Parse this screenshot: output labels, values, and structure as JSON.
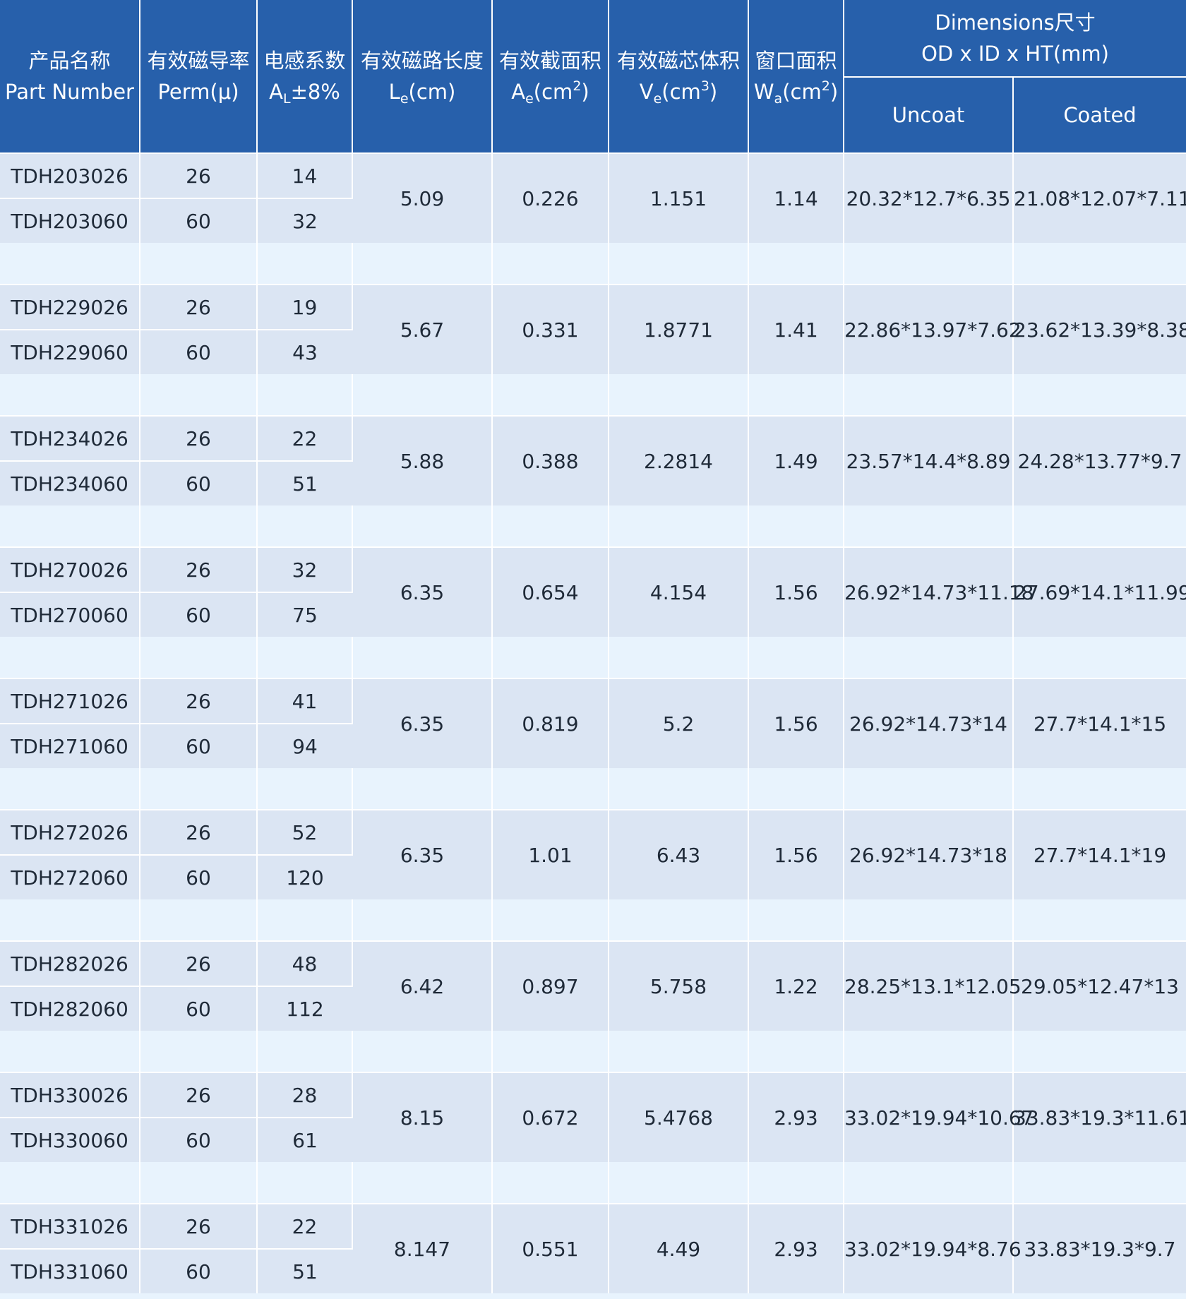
{
  "header": {
    "part_cn": "产品名称",
    "part_en": "Part Number",
    "perm_cn": "有效磁导率",
    "perm_en": "Perm(μ)",
    "al_cn": "电感系数",
    "al_sym": "A",
    "al_sub": "L",
    "al_tail": "±8%",
    "le_cn": "有效磁路长度",
    "le_sym": "L",
    "le_sub": "e",
    "le_unit": "(cm)",
    "ae_cn": "有效截面积",
    "ae_sym": "A",
    "ae_sub": "e",
    "ae_unit": "(cm",
    "ae_sup": "2",
    "ae_close": ")",
    "ve_cn": "有效磁芯体积",
    "ve_sym": "V",
    "ve_sub": "e",
    "ve_unit": "(cm",
    "ve_sup": "3",
    "ve_close": ")",
    "wa_cn": "窗口面积",
    "wa_sym": "W",
    "wa_sub": "a",
    "wa_unit": "(cm",
    "wa_sup": "2",
    "wa_close": ")",
    "dim_title": "Dimensions尺寸",
    "dim_sub": "OD x ID x HT(mm)",
    "uncoat": "Uncoat",
    "coated": "Coated"
  },
  "groups": [
    {
      "parts": [
        {
          "pn": "TDH203026",
          "perm": "26",
          "al": "14"
        },
        {
          "pn": "TDH203060",
          "perm": "60",
          "al": "32"
        }
      ],
      "le": "5.09",
      "ae": "0.226",
      "ve": "1.151",
      "wa": "1.14",
      "uncoat": "20.32*12.7*6.35",
      "coated": "21.08*12.07*7.11"
    },
    {
      "parts": [
        {
          "pn": "TDH229026",
          "perm": "26",
          "al": "19"
        },
        {
          "pn": "TDH229060",
          "perm": "60",
          "al": "43"
        }
      ],
      "le": "5.67",
      "ae": "0.331",
      "ve": "1.8771",
      "wa": "1.41",
      "uncoat": "22.86*13.97*7.62",
      "coated": "23.62*13.39*8.38"
    },
    {
      "parts": [
        {
          "pn": "TDH234026",
          "perm": "26",
          "al": "22"
        },
        {
          "pn": "TDH234060",
          "perm": "60",
          "al": "51"
        }
      ],
      "le": "5.88",
      "ae": "0.388",
      "ve": "2.2814",
      "wa": "1.49",
      "uncoat": "23.57*14.4*8.89",
      "coated": "24.28*13.77*9.7"
    },
    {
      "parts": [
        {
          "pn": "TDH270026",
          "perm": "26",
          "al": "32"
        },
        {
          "pn": "TDH270060",
          "perm": "60",
          "al": "75"
        }
      ],
      "le": "6.35",
      "ae": "0.654",
      "ve": "4.154",
      "wa": "1.56",
      "uncoat": "26.92*14.73*11.18",
      "coated": "27.69*14.1*11.99"
    },
    {
      "parts": [
        {
          "pn": "TDH271026",
          "perm": "26",
          "al": "41"
        },
        {
          "pn": "TDH271060",
          "perm": "60",
          "al": "94"
        }
      ],
      "le": "6.35",
      "ae": "0.819",
      "ve": "5.2",
      "wa": "1.56",
      "uncoat": "26.92*14.73*14",
      "coated": "27.7*14.1*15"
    },
    {
      "parts": [
        {
          "pn": "TDH272026",
          "perm": "26",
          "al": "52"
        },
        {
          "pn": "TDH272060",
          "perm": "60",
          "al": "120"
        }
      ],
      "le": "6.35",
      "ae": "1.01",
      "ve": "6.43",
      "wa": "1.56",
      "uncoat": "26.92*14.73*18",
      "coated": "27.7*14.1*19"
    },
    {
      "parts": [
        {
          "pn": "TDH282026",
          "perm": "26",
          "al": "48"
        },
        {
          "pn": "TDH282060",
          "perm": "60",
          "al": "112"
        }
      ],
      "le": "6.42",
      "ae": "0.897",
      "ve": "5.758",
      "wa": "1.22",
      "uncoat": "28.25*13.1*12.05",
      "coated": "29.05*12.47*13"
    },
    {
      "parts": [
        {
          "pn": "TDH330026",
          "perm": "26",
          "al": "28"
        },
        {
          "pn": "TDH330060",
          "perm": "60",
          "al": "61"
        }
      ],
      "le": "8.15",
      "ae": "0.672",
      "ve": "5.4768",
      "wa": "2.93",
      "uncoat": "33.02*19.94*10.67",
      "coated": "33.83*19.3*11.61"
    },
    {
      "parts": [
        {
          "pn": "TDH331026",
          "perm": "26",
          "al": "22"
        },
        {
          "pn": "TDH331060",
          "perm": "60",
          "al": "51"
        }
      ],
      "le": "8.147",
      "ae": "0.551",
      "ve": "4.49",
      "wa": "2.93",
      "uncoat": "33.02*19.94*8.76",
      "coated": "33.83*19.3*9.7"
    }
  ]
}
